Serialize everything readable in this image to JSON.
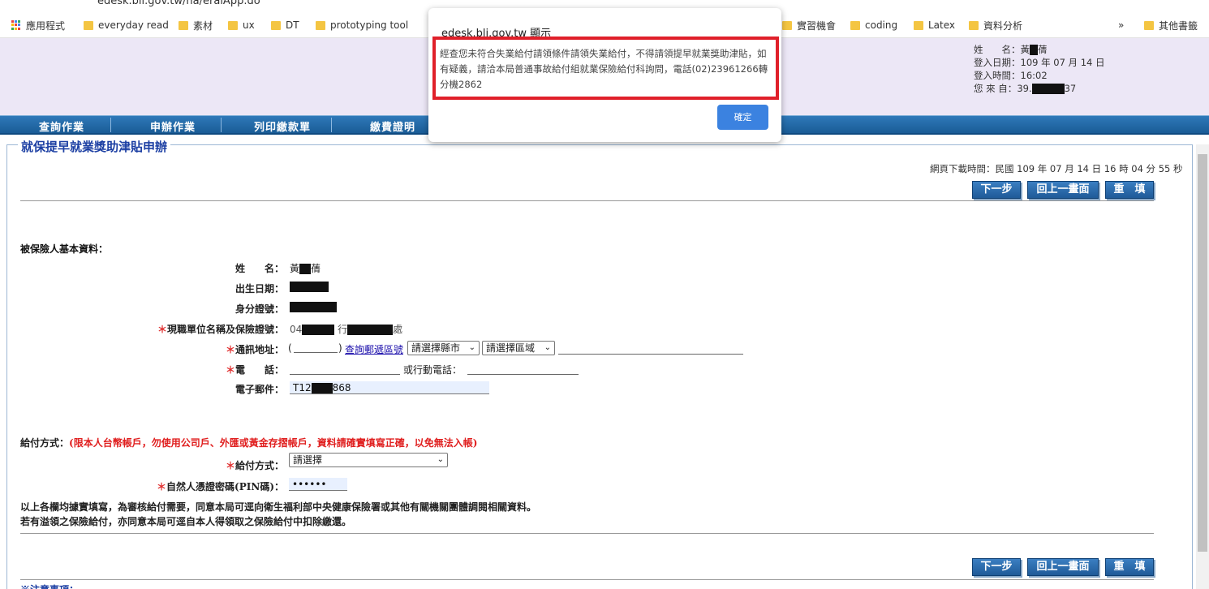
{
  "browser": {
    "url": "edesk.bli.gov.tw/na/eraiApp.do",
    "bookmarks": [
      "應用程式",
      "everyday read",
      "素材",
      "ux",
      "DT",
      "prototyping tool",
      "實習機會",
      "coding",
      "Latex",
      "資料分析",
      "其他書籤"
    ],
    "overflow": "»"
  },
  "user": {
    "name_label": "姓　　名：",
    "name_value": "黃",
    "name_suffix": "蒨",
    "login_date_label": "登入日期：",
    "login_date": "109 年 07 月 14 日",
    "login_time_label": "登入時間：",
    "login_time": "16:02",
    "from_label": "您 來 自：",
    "from_prefix": "39.",
    "from_suffix": "37"
  },
  "nav": [
    "查詢作業",
    "申辦作業",
    "列印繳款單",
    "繳費證明"
  ],
  "panel": {
    "title": "就保提早就業獎助津貼申辦",
    "download_time": "網頁下載時間：民國 109 年 07 月 14 日 16 時 04 分 55 秒",
    "buttons": {
      "next": "下一步",
      "back": "回上一畫面",
      "reset": "重　填"
    }
  },
  "form": {
    "section_basic": "被保險人基本資料：",
    "name_label": "姓　　名：",
    "name_value": "黃",
    "name_suffix": "蒨",
    "birth_label": "出生日期：",
    "id_label": "身分證號：",
    "employer_label": "現職單位名稱及保險證號：",
    "employer_prefix": "04",
    "employer_mid": "行",
    "employer_suffix": "處",
    "address_label": "通訊地址：",
    "zip_open": "(",
    "zip_close": ")",
    "zip_link": "查詢郵遞區號",
    "city_select": "請選擇縣市",
    "district_select": "請選擇區域",
    "phone_label": "電　　話：",
    "mobile_label": "或行動電話：",
    "email_label": "電子郵件：",
    "email_prefix": "T12",
    "email_suffix": "868",
    "payment_section": "給付方式：",
    "payment_warning": "(限本人台幣帳戶，勿使用公司戶、外匯或黃金存摺帳戶，資料請確實填寫正確，以免無法入帳)",
    "payment_method_label": "給付方式：",
    "payment_method_value": "請選擇",
    "pin_label": "自然人憑證密碼(PIN碼)：",
    "pin_value": "••••••",
    "note1": "以上各欄均據實填寫，為審核給付需要，同意本局可逕向衛生福利部中央健康保險署或其他有關機關團體調閱相關資料。",
    "note2": "若有溢領之保險給付，亦同意本局可逕自本人得領取之保險給付中扣除繳還。",
    "notice_heading": "※注意事項："
  },
  "dialog": {
    "title": "edesk.bli.gov.tw 顯示",
    "message": "經查您未符合失業給付請領條件請領失業給付，不得請領提早就業獎助津貼，如有疑義，請洽本局普通事故給付組就業保險給付科詢問，電話(02)23961266轉分機2862",
    "ok": "確定"
  },
  "colors": {
    "nav": "#1a5c96",
    "title": "#1c3fa3",
    "warning": "#e02020",
    "highlight": "#e0202a",
    "ok": "#3b82e0"
  }
}
